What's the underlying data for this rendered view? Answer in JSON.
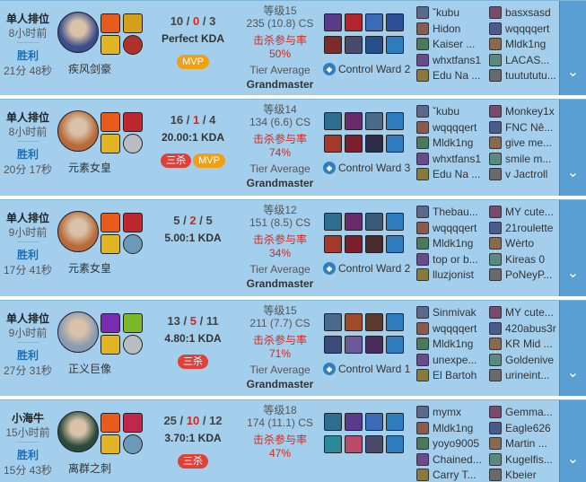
{
  "matches": [
    {
      "mode": "单人排位",
      "ago": "8小时前",
      "result": "胜利",
      "duration": "21分 48秒",
      "champion": "疾风剑豪",
      "kills": "10",
      "deaths": "0",
      "assists": "3",
      "kda": "Perfect KDA",
      "badges": [
        {
          "text": "MVP",
          "type": "mvp"
        }
      ],
      "level": "等级15",
      "cs": "235 (10.8) CS",
      "kp_label": "击杀参与率",
      "kp": "50%",
      "tier_label": "Tier Average",
      "tier": "Grandmaster",
      "ward": "Control Ward 2",
      "portrait_color": "#3b4e8c",
      "spell1": "#e85b1a",
      "spell2": "#d4a019",
      "spell3": "#e0b424",
      "spell4": "#b0312a",
      "items": [
        "#5b3a8a",
        "#b2262b",
        "#3a6ab8",
        "#2f4f9a",
        "#7a2b2b",
        "#4a4a6a",
        "#274e89",
        "#2e7cc0"
      ],
      "allies": [
        "ˇkubu",
        "Hidon",
        "Kaiser ...",
        "whxtfans1",
        "Edu Na ..."
      ],
      "enemies": [
        "basxsasd",
        "wqqqqert",
        "Mldk1ng",
        "LACAS...",
        "tuutututu..."
      ]
    },
    {
      "mode": "单人排位",
      "ago": "8小时前",
      "result": "胜利",
      "duration": "20分 17秒",
      "champion": "元素女皇",
      "kills": "16",
      "deaths": "1",
      "assists": "4",
      "kda": "20.00:1 KDA",
      "badges": [
        {
          "text": "三杀",
          "type": "kill"
        },
        {
          "text": "MVP",
          "type": "mvp"
        }
      ],
      "level": "等级14",
      "cs": "134 (6.6) CS",
      "kp_label": "击杀参与率",
      "kp": "74%",
      "tier_label": "Tier Average",
      "tier": "Grandmaster",
      "ward": "Control Ward 3",
      "portrait_color": "#b86b38",
      "spell1": "#e85b1a",
      "spell2": "#c0262e",
      "spell3": "#e0b424",
      "spell4": "#b9bcc0",
      "items": [
        "#2f6d8f",
        "#6a2b6a",
        "#4a6a8a",
        "#2e7cc0",
        "#a13a2a",
        "#7a1f2b",
        "#2b2b4a",
        "#2e7cc0"
      ],
      "allies": [
        "ˇkubu",
        "wqqqqert",
        "Mldk1ng",
        "whxtfans1",
        "Edu Na ..."
      ],
      "enemies": [
        "Monkey1x",
        "FNC Nê...",
        "give me...",
        "smile m...",
        "v Jactroll"
      ]
    },
    {
      "mode": "单人排位",
      "ago": "9小时前",
      "result": "胜利",
      "duration": "17分 41秒",
      "champion": "元素女皇",
      "kills": "5",
      "deaths": "2",
      "assists": "5",
      "kda": "5.00:1 KDA",
      "badges": [],
      "level": "等级12",
      "cs": "151 (8.5) CS",
      "kp_label": "击杀参与率",
      "kp": "34%",
      "tier_label": "Tier Average",
      "tier": "Grandmaster",
      "ward": "Control Ward 2",
      "portrait_color": "#b86b38",
      "spell1": "#e85b1a",
      "spell2": "#c0262e",
      "spell3": "#e0b424",
      "spell4": "#6a9ab8",
      "items": [
        "#2f6d8f",
        "#6a2b6a",
        "#3a5a7a",
        "#2e7cc0",
        "#a13a2a",
        "#7a1f2b",
        "#4a2b2b",
        "#2e7cc0"
      ],
      "allies": [
        "Thebau...",
        "wqqqqert",
        "Mldk1ng",
        "top or b...",
        "lluzjonist"
      ],
      "enemies": [
        "MY cute...",
        "21roulette",
        "Wèrto",
        "Kireas 0",
        "PoNeyP..."
      ]
    },
    {
      "mode": "单人排位",
      "ago": "9小时前",
      "result": "胜利",
      "duration": "27分 31秒",
      "champion": "正义巨像",
      "kills": "13",
      "deaths": "5",
      "assists": "11",
      "kda": "4.80:1 KDA",
      "badges": [
        {
          "text": "三杀",
          "type": "kill"
        }
      ],
      "level": "等级15",
      "cs": "211 (7.7) CS",
      "kp_label": "击杀参与率",
      "kp": "71%",
      "tier_label": "Tier Average",
      "tier": "Grandmaster",
      "ward": "Control Ward 1",
      "portrait_color": "#8a9ab0",
      "spell1": "#7a2bb0",
      "spell2": "#7ab82a",
      "spell3": "#e0b424",
      "spell4": "#b9bcc0",
      "items": [
        "#4a6a8a",
        "#a14a2a",
        "#5a3a2a",
        "#2e7cc0",
        "#3a4a7a",
        "#6a5a9a",
        "#4a2b5a",
        "#2e7cc0"
      ],
      "allies": [
        "Sinmivak",
        "wqqqqert",
        "Mldk1ng",
        "unexpe...",
        "El Bartoh"
      ],
      "enemies": [
        "MY cute...",
        "420abus3r",
        "KR Mid ...",
        "Goldenive",
        "urineint..."
      ]
    },
    {
      "mode": "小海牛",
      "ago": "15小时前",
      "result": "胜利",
      "duration": "15分 43秒",
      "champion": "离群之刺",
      "kills": "25",
      "deaths": "10",
      "assists": "12",
      "kda": "3.70:1 KDA",
      "badges": [
        {
          "text": "三杀",
          "type": "kill"
        }
      ],
      "level": "等级18",
      "cs": "174 (11.1) CS",
      "kp_label": "击杀参与率",
      "kp": "47%",
      "tier_label": "",
      "tier": "",
      "ward": "",
      "portrait_color": "#2a4a3a",
      "spell1": "#e85b1a",
      "spell2": "#c0264e",
      "spell3": "#e0b424",
      "spell4": "#6a9ab8",
      "items": [
        "#2f6d8f",
        "#5a3a8a",
        "#3a6ab8",
        "#2e7cc0",
        "#2a8a9a",
        "#b84a6a",
        "#4a4a6a",
        "#2e7cc0"
      ],
      "allies": [
        "mymx",
        "Mldk1ng",
        "yoyo9005",
        "Chained...",
        "Carry T..."
      ],
      "enemies": [
        "Gemma...",
        "Eagle626",
        "Martin ...",
        "Kugelfis...",
        "Kbeier"
      ]
    }
  ],
  "expand_icon": "chevron-down-icon",
  "expand_glyph": "⌄"
}
